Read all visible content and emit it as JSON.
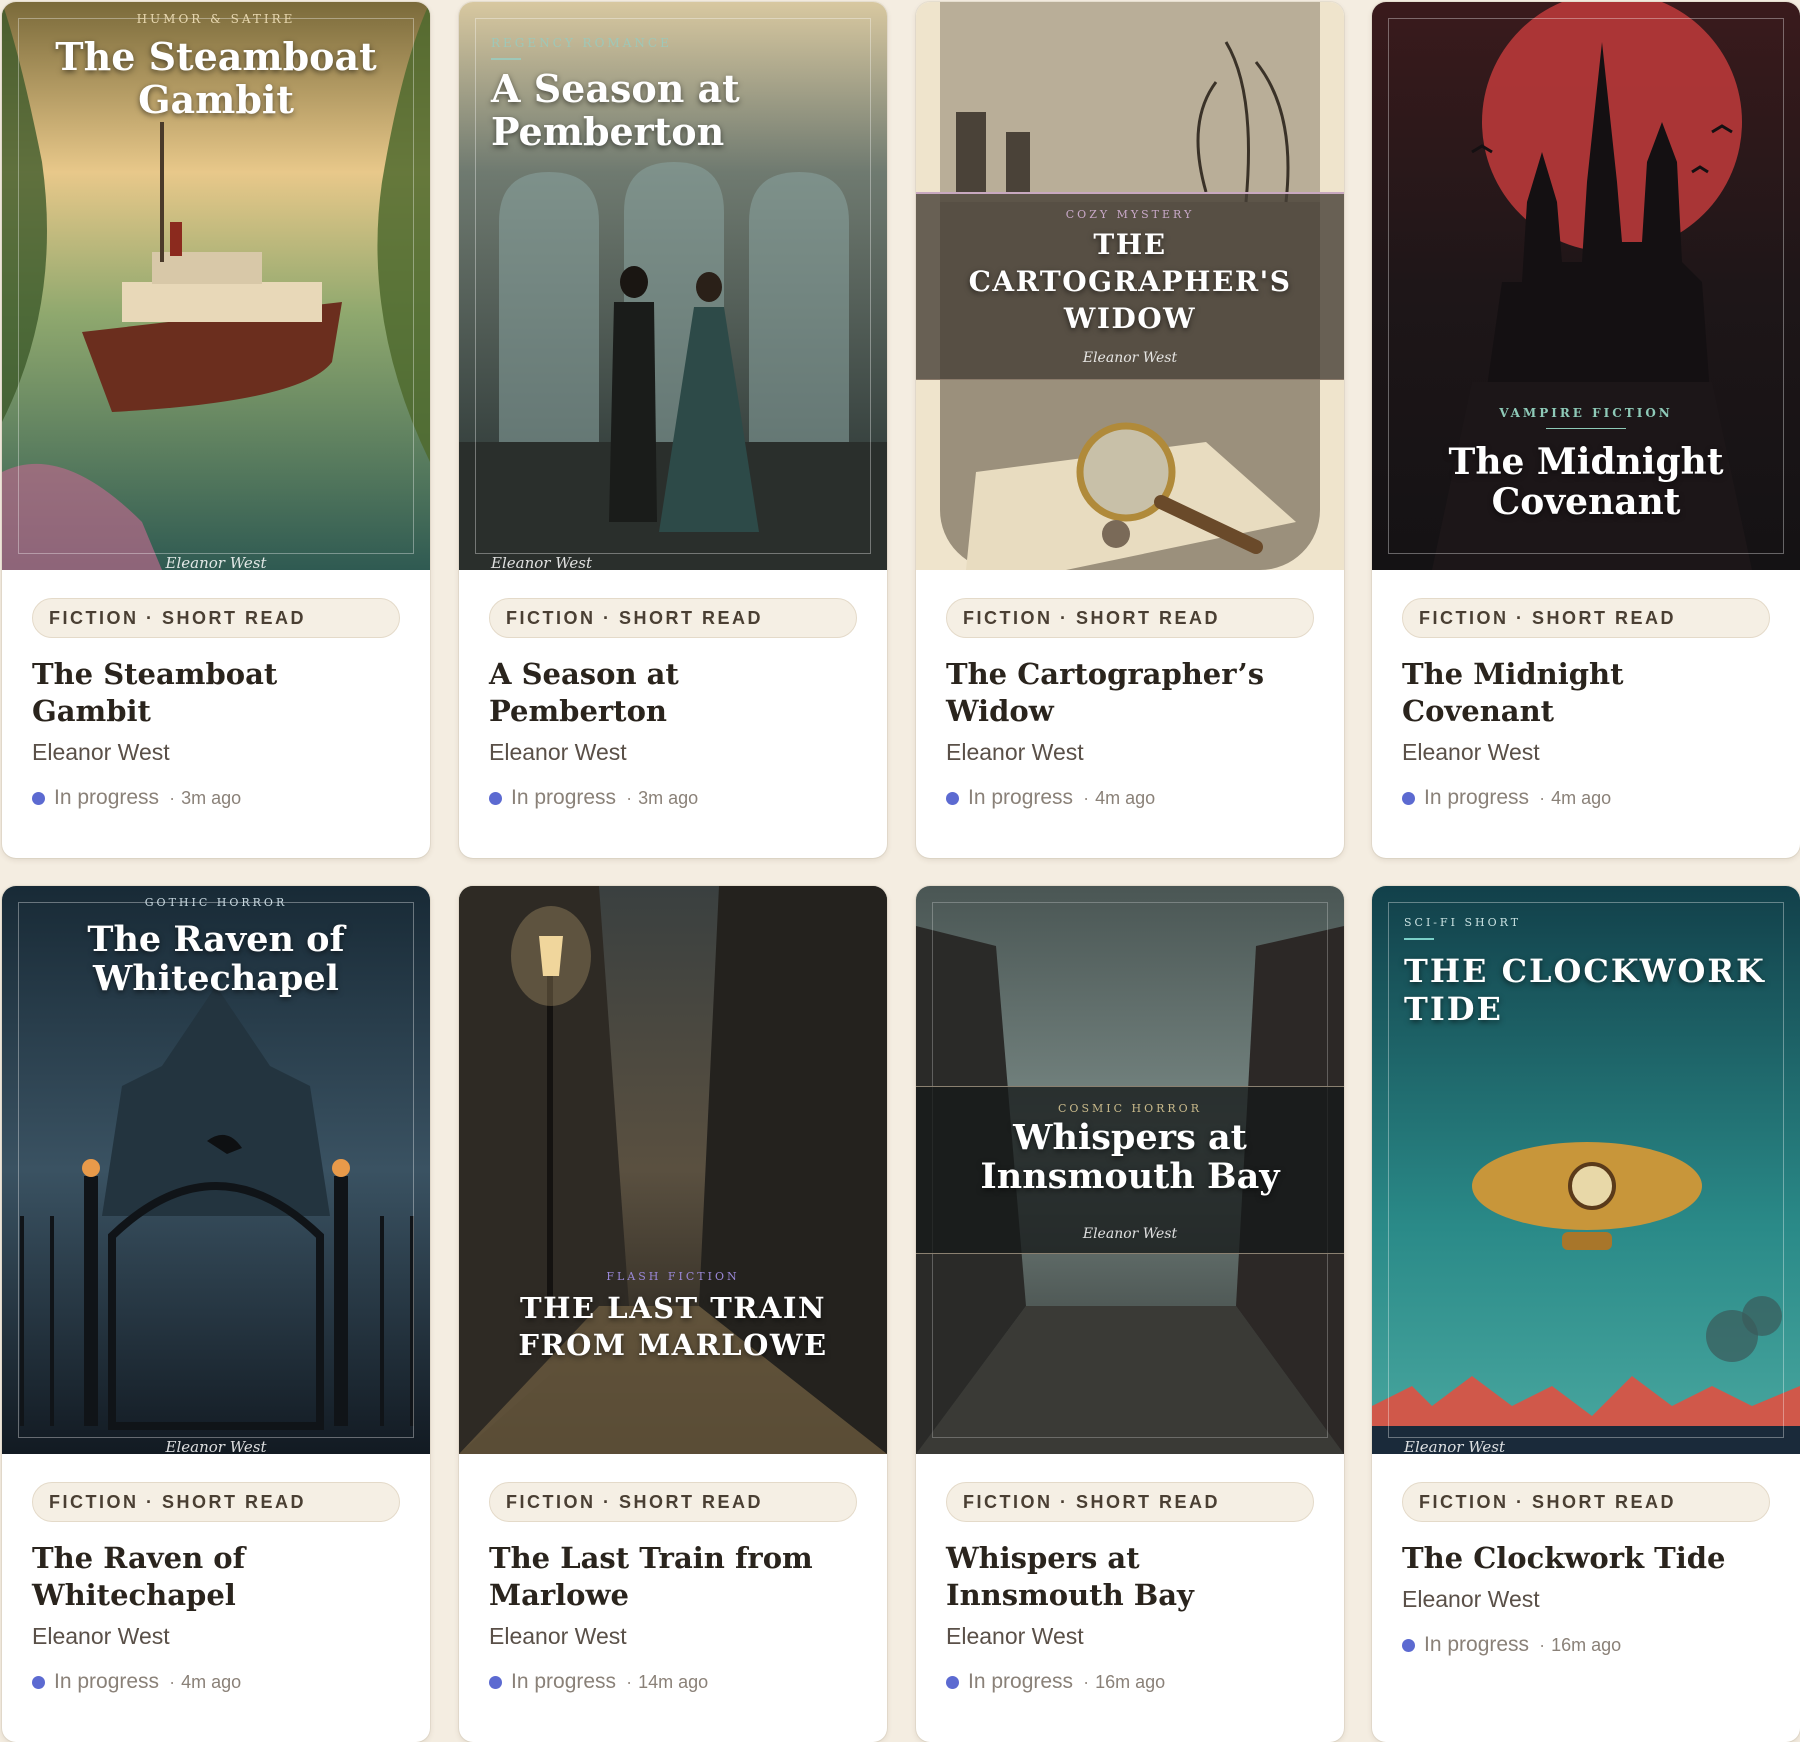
{
  "author": "Eleanor West",
  "badge": "FICTION · SHORT READ",
  "status": "In progress",
  "separator": "·",
  "colors": {
    "background": "#f4ede1",
    "status_dot": "#5c6ad1",
    "badge_bg": "#f5efe4"
  },
  "books": [
    {
      "title": "The Steamboat Gambit",
      "genre": "HUMOR & SATIRE",
      "cover_title": "The Steamboat Gambit",
      "time": "3m ago",
      "cover_theme": "river-steamboat"
    },
    {
      "title": "A Season at Pemberton",
      "genre": "REGENCY ROMANCE",
      "cover_title": "A Season at Pemberton",
      "time": "3m ago",
      "cover_theme": "ballroom-couple"
    },
    {
      "title": "The Cartographer’s Widow",
      "genre": "COZY MYSTERY",
      "cover_title": "THE CARTOGRAPHER'S WIDOW",
      "time": "4m ago",
      "cover_theme": "magnifier-letters"
    },
    {
      "title": "The Midnight Covenant",
      "genre": "VAMPIRE FICTION",
      "cover_title": "The Midnight Covenant",
      "time": "4m ago",
      "cover_theme": "red-moon-castle"
    },
    {
      "title": "The Raven of Whitechapel",
      "genre": "GOTHIC HORROR",
      "cover_title": "The Raven of Whitechapel",
      "time": "4m ago",
      "cover_theme": "gate-mansion"
    },
    {
      "title": "The Last Train from Marlowe",
      "genre": "FLASH FICTION",
      "cover_title": "THE LAST TRAIN FROM MARLOWE",
      "time": "14m ago",
      "cover_theme": "rainy-alley"
    },
    {
      "title": "Whispers at Innsmouth Bay",
      "genre": "COSMIC HORROR",
      "cover_title": "Whispers at Innsmouth Bay",
      "time": "16m ago",
      "cover_theme": "foggy-street"
    },
    {
      "title": "The Clockwork Tide",
      "genre": "SCI-FI SHORT",
      "cover_title": "THE CLOCKWORK TIDE",
      "time": "16m ago",
      "cover_theme": "airship-rooftops"
    }
  ]
}
